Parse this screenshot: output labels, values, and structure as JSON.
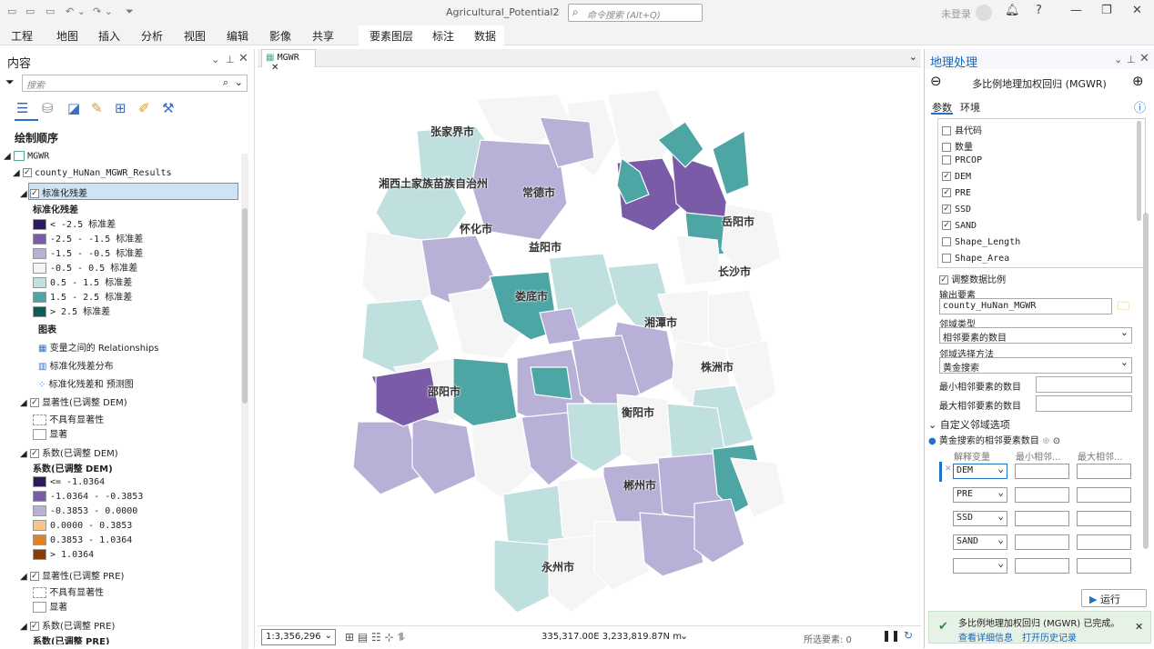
{
  "app": {
    "window_title": "Agricultural_Potential2",
    "command_search_placeholder": "命令搜索 (Alt+Q)",
    "user": "未登录"
  },
  "ribbon_tabs": [
    "工程",
    "地图",
    "插入",
    "分析",
    "视图",
    "编辑",
    "影像",
    "共享",
    "要素图层",
    "标注",
    "数据"
  ],
  "contents": {
    "title": "内容",
    "search_placeholder": "搜索",
    "section": "绘制顺序",
    "map_name": "MGWR",
    "layer_name": "county_HuNan_MGWR_Results",
    "sel_layer": "标准化残差",
    "legend_title": "标准化残差",
    "residual_classes": [
      {
        "label": "< -2.5 标准差",
        "color": "#2e1a5e"
      },
      {
        "label": "-2.5 - -1.5 标准差",
        "color": "#7a5ba8"
      },
      {
        "label": "-1.5 - -0.5 标准差",
        "color": "#b8b0d6"
      },
      {
        "label": "-0.5 - 0.5 标准差",
        "color": "#f5f5f5"
      },
      {
        "label": "0.5 - 1.5 标准差",
        "color": "#bfe0df"
      },
      {
        "label": "1.5 - 2.5 标准差",
        "color": "#4ea6a4"
      },
      {
        "label": "> 2.5 标准差",
        "color": "#0d5e5a"
      }
    ],
    "charts_header": "图表",
    "charts": [
      "变量之间的 Relationships",
      "标准化残差分布",
      "标准化残差和 预测图"
    ],
    "sig_dem": "显著性(已调整 DEM)",
    "not_sig": "不具有显著性",
    "sig": "显著",
    "coef_dem_layer": "系数(已调整 DEM)",
    "coef_dem_title": "系数(已调整 DEM)",
    "coef_classes": [
      {
        "label": "<= -1.0364",
        "color": "#2e1a5e"
      },
      {
        "label": "-1.0364 - -0.3853",
        "color": "#7a5ba8"
      },
      {
        "label": "-0.3853 - 0.0000",
        "color": "#b8b0d6"
      },
      {
        "label": "0.0000 - 0.3853",
        "color": "#f8c488"
      },
      {
        "label": "0.3853 - 1.0364",
        "color": "#e0821e"
      },
      {
        "label": "> 1.0364",
        "color": "#8a3a06"
      }
    ],
    "sig_pre": "显著性(已调整 PRE)",
    "coef_pre_layer": "系数(已调整 PRE)",
    "coef_pre_title_partial": "系数(已调整 PRE)"
  },
  "map": {
    "tab": "MGWR",
    "scale": "1:3,356,296",
    "coords": "335,317.00E 3,233,819.87N m",
    "selected": "所选要素: 0",
    "labels": [
      "张家界市",
      "湘西土家族苗族自治州",
      "常德市",
      "岳阳市",
      "怀化市",
      "益阳市",
      "长沙市",
      "娄底市",
      "湘潭市",
      "株洲市",
      "邵阳市",
      "衡阳市",
      "郴州市",
      "永州市"
    ]
  },
  "geo": {
    "title": "地理处理",
    "tool": "多比例地理加权回归 (MGWR)",
    "tab_params": "参数",
    "tab_env": "环境",
    "fields": [
      {
        "name": "县代码",
        "checked": false
      },
      {
        "name": "数量",
        "checked": false
      },
      {
        "name": "PRCOP",
        "checked": false
      },
      {
        "name": "DEM",
        "checked": true
      },
      {
        "name": "PRE",
        "checked": true
      },
      {
        "name": "SSD",
        "checked": true
      },
      {
        "name": "SAND",
        "checked": true
      },
      {
        "name": "Shape_Length",
        "checked": false
      },
      {
        "name": "Shape_Area",
        "checked": false
      }
    ],
    "scale_data": "调整数据比例",
    "output_label": "输出要素",
    "output_value": "county_HuNan_MGWR",
    "nb_type_label": "邻域类型",
    "nb_type_value": "相邻要素的数目",
    "nb_sel_label": "邻域选择方法",
    "nb_sel_value": "黄金搜索",
    "min_nb": "最小相邻要素的数目",
    "max_nb": "最大相邻要素的数目",
    "custom_section": "自定义邻域选项",
    "golden_label": "黄金搜索的相邻要素数目",
    "col_var": "解释变量",
    "col_min": "最小相邻...",
    "col_max": "最大相邻...",
    "rows": [
      "DEM",
      "PRE",
      "SSD",
      "SAND",
      ""
    ],
    "run": "运行",
    "done_msg": "多比例地理加权回归 (MGWR) 已完成。",
    "details": "查看详细信息",
    "history": "打开历史记录"
  }
}
